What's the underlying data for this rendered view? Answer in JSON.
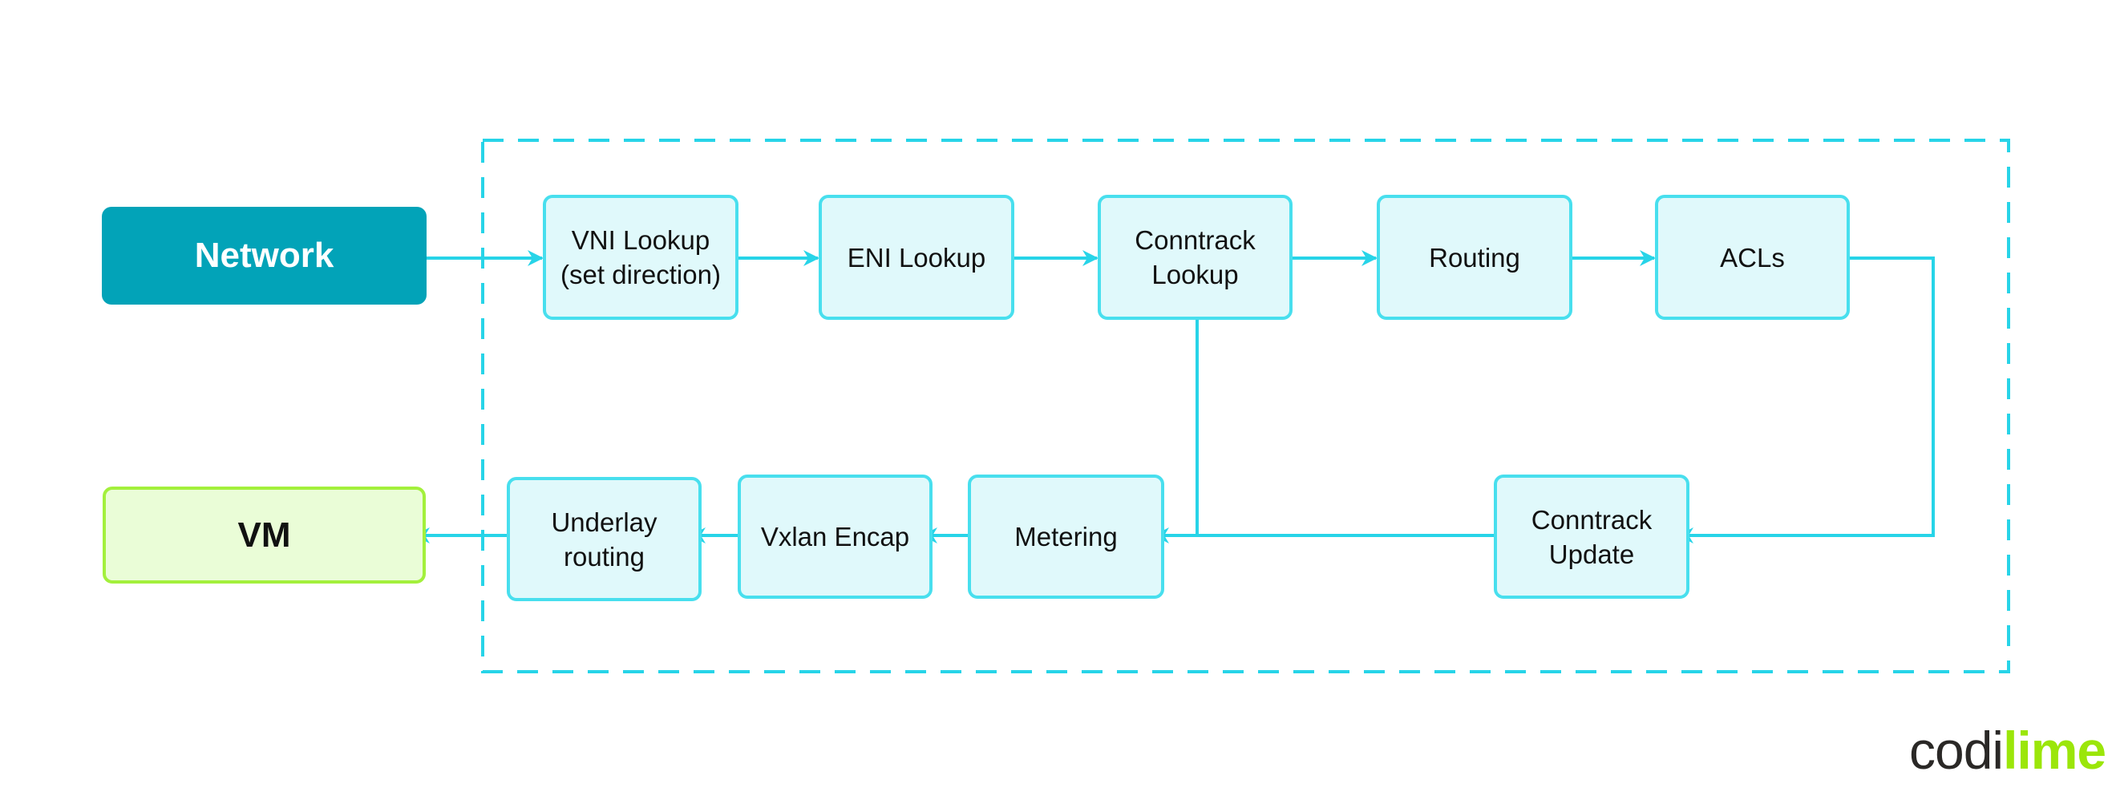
{
  "diagram": {
    "colors": {
      "connector": "#27d4e8",
      "stage_fill": "#e0f9fb",
      "stage_border": "#48dfee",
      "network_fill": "#02a3b8",
      "vm_fill": "#eafdd7",
      "vm_border": "#a3f03c"
    },
    "endpoints": {
      "network": "Network",
      "vm": "VM"
    },
    "pipeline": {
      "top_row": [
        "VNI Lookup\n(set direction)",
        "ENI Lookup",
        "Conntrack\nLookup",
        "Routing",
        "ACLs"
      ],
      "bottom_row": [
        "Underlay\nrouting",
        "Vxlan Encap",
        "Metering",
        "Conntrack\nUpdate"
      ]
    },
    "edges": [
      [
        "Network",
        "VNI Lookup"
      ],
      [
        "VNI Lookup",
        "ENI Lookup"
      ],
      [
        "ENI Lookup",
        "Conntrack Lookup"
      ],
      [
        "Conntrack Lookup",
        "Routing"
      ],
      [
        "Routing",
        "ACLs"
      ],
      [
        "ACLs",
        "Conntrack Update"
      ],
      [
        "Conntrack Update",
        "Metering"
      ],
      [
        "Conntrack Lookup",
        "Metering"
      ],
      [
        "Metering",
        "Vxlan Encap"
      ],
      [
        "Vxlan Encap",
        "Underlay routing"
      ],
      [
        "Underlay routing",
        "VM"
      ]
    ]
  },
  "logo": {
    "part1": "codi",
    "part2": "lime"
  }
}
